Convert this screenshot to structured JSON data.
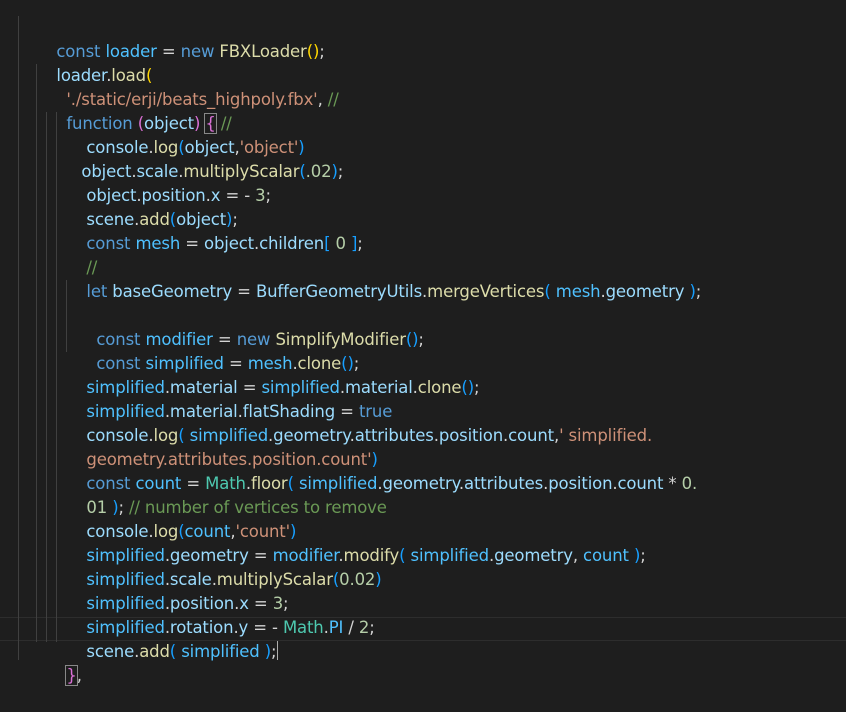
{
  "editor": {
    "language": "javascript",
    "lines": [
      "const loader = new FBXLoader();",
      "loader.load(",
      "'./static/erji/beats_highpoly.fbx', //",
      "function (object) { //",
      "console.log(object,'object')",
      "object.scale.multiplyScalar(.02);",
      "object.position.x = - 3;",
      "scene.add(object);",
      "const mesh = object.children[ 0 ];",
      "//",
      "let baseGeometry = BufferGeometryUtils.mergeVertices( mesh.geometry );",
      "",
      "const modifier = new SimplifyModifier();",
      "const simplified = mesh.clone();",
      "simplified.material = simplified.material.clone();",
      "simplified.material.flatShading = true",
      "console.log( simplified.geometry.attributes.position.count,' simplified.",
      "geometry.attributes.position.count')",
      "const count = Math.floor( simplified.geometry.attributes.position.count * 0.",
      "01 ); // number of vertices to remove",
      "console.log(count,'count')",
      "simplified.geometry = modifier.modify( simplified.geometry, count );",
      "simplified.scale.multiplyScalar(0.02)",
      "simplified.position.x = 3;",
      "simplified.rotation.y = - Math.PI / 2;",
      "scene.add( simplified );",
      "},"
    ]
  },
  "colors": {
    "background": "#1e1e1e",
    "keyword": "#569cd6",
    "variable": "#9cdcfe",
    "constant": "#4fc1ff",
    "function": "#dcdcaa",
    "type": "#4ec9b0",
    "string": "#ce9178",
    "number": "#b5cea8",
    "comment": "#6a9955"
  }
}
